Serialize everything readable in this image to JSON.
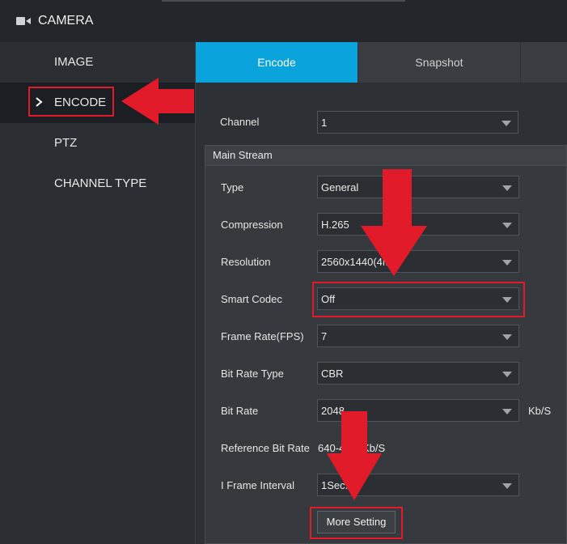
{
  "header": {
    "title": "CAMERA",
    "icon": "camera-icon"
  },
  "sidebar": {
    "items": [
      {
        "label": "IMAGE"
      },
      {
        "label": "ENCODE",
        "active": true
      },
      {
        "label": "PTZ"
      },
      {
        "label": "CHANNEL TYPE"
      }
    ]
  },
  "tabs": [
    {
      "label": "Encode",
      "active": true
    },
    {
      "label": "Snapshot"
    }
  ],
  "channel": {
    "label": "Channel",
    "value": "1"
  },
  "main_stream": {
    "title": "Main Stream",
    "fields": {
      "type": {
        "label": "Type",
        "value": "General"
      },
      "compression": {
        "label": "Compression",
        "value": "H.265"
      },
      "resolution": {
        "label": "Resolution",
        "value": "2560x1440(4M)"
      },
      "smart_codec": {
        "label": "Smart Codec",
        "value": "Off"
      },
      "frame_rate": {
        "label": "Frame Rate(FPS)",
        "value": "7"
      },
      "bit_rate_type": {
        "label": "Bit Rate Type",
        "value": "CBR"
      },
      "bit_rate": {
        "label": "Bit Rate",
        "value": "2048",
        "unit": "Kb/S"
      },
      "reference_bit_rate": {
        "label": "Reference Bit Rate",
        "value": "640-4096Kb/S"
      },
      "i_frame_interval": {
        "label": "I Frame Interval",
        "value": "1Sec."
      }
    },
    "more_setting_label": "More Setting"
  },
  "colors": {
    "accent": "#0aa3dc",
    "highlight": "#e21b2a"
  }
}
